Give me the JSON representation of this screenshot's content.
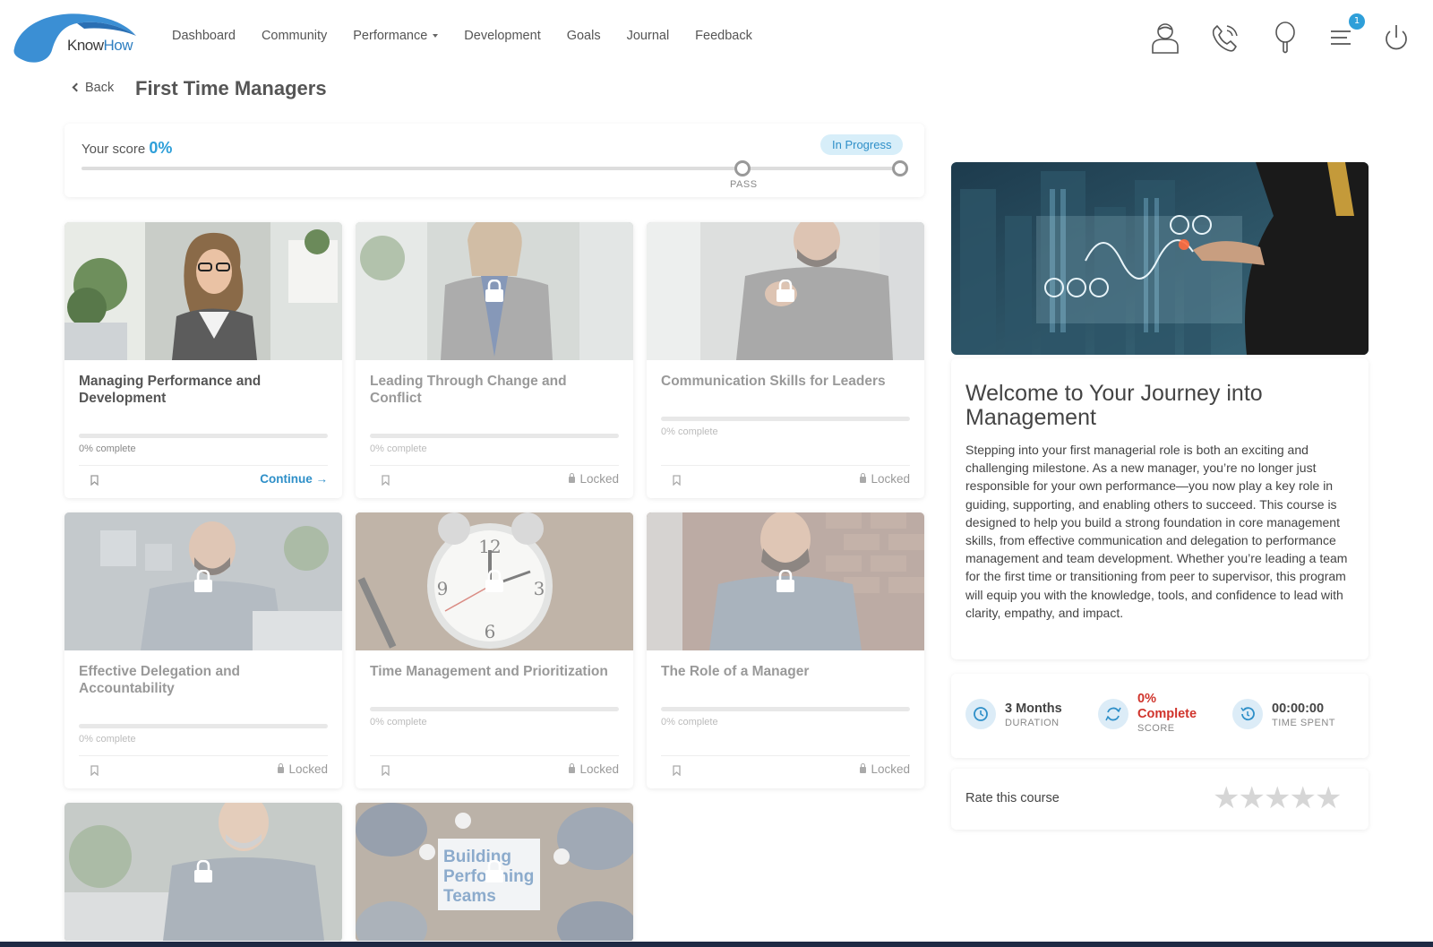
{
  "app": {
    "logo_text_1": "Know",
    "logo_text_2": "How",
    "notification_count": "1"
  },
  "nav": [
    {
      "label": "Dashboard"
    },
    {
      "label": "Community"
    },
    {
      "label": "Performance"
    },
    {
      "label": "Development"
    },
    {
      "label": "Goals"
    },
    {
      "label": "Journal"
    },
    {
      "label": "Feedback"
    }
  ],
  "header_icons": [
    "profile-icon",
    "phone-icon",
    "search-icon",
    "menu-icon",
    "power-icon"
  ],
  "page": {
    "back_label": "Back",
    "title": "First Time Managers"
  },
  "score": {
    "label": "Your score",
    "value": "0%",
    "status": "In Progress",
    "pass_label": "PASS",
    "progress_fraction": 0.0,
    "pass_fraction": 0.807
  },
  "courses": [
    {
      "title": "Managing Performance and Development",
      "complete": "0% complete",
      "progress": 0,
      "action": "Continue",
      "locked": false,
      "image": "woman-in-blazer"
    },
    {
      "title": "Leading Through Change and Conflict",
      "complete": "0% complete",
      "progress": 0,
      "action": "Locked",
      "locked": true,
      "image": "woman-at-window"
    },
    {
      "title": "Communication Skills for Leaders",
      "complete": "0% complete",
      "progress": 0,
      "action": "Locked",
      "locked": true,
      "image": "man-clasping-hands"
    },
    {
      "title": "Effective Delegation and Accountability",
      "complete": "0% complete",
      "progress": 0,
      "action": "Locked",
      "locked": true,
      "image": "man-thinking"
    },
    {
      "title": "Time Management and Prioritization",
      "complete": "0% complete",
      "progress": 0,
      "action": "Locked",
      "locked": true,
      "image": "alarm-clock"
    },
    {
      "title": "The Role of a Manager",
      "complete": "0% complete",
      "progress": 0,
      "action": "Locked",
      "locked": true,
      "image": "smiling-man-brick"
    },
    {
      "title": "",
      "complete": "",
      "progress": 0,
      "action": "Locked",
      "locked": true,
      "image": "man-with-laptop"
    },
    {
      "title": "",
      "complete": "",
      "progress": 0,
      "action": "Locked",
      "locked": true,
      "image": "building-performing-teams",
      "image_text": [
        "Building",
        "Performing",
        "Teams"
      ]
    }
  ],
  "welcome": {
    "title": "Welcome to Your Journey into Management",
    "body": "Stepping into your first managerial role is both an exciting and challenging milestone. As a new manager, you’re no longer just responsible for your own performance—you now play a key role in guiding, supporting, and enabling others to succeed. This course is designed to help you build a strong foundation in core management skills, from effective communication and delegation to performance management and team development. Whether you’re leading a team for the first time or transitioning from peer to supervisor, this program will equip you with the knowledge, tools, and confidence to lead with clarity, empathy, and impact."
  },
  "stats": [
    {
      "main": "3 Months",
      "sub": "DURATION",
      "icon": "clock-icon",
      "color": "#444444"
    },
    {
      "main": "0% Complete",
      "main_line1": "0%",
      "main_line2": "Complete",
      "sub": "SCORE",
      "icon": "refresh-icon",
      "color": "#d0342c"
    },
    {
      "main": "00:00:00",
      "sub": "TIME SPENT",
      "icon": "history-icon",
      "color": "#444444"
    }
  ],
  "rating": {
    "label": "Rate this course",
    "stars": 5,
    "value": 0
  },
  "colors": {
    "accent": "#2e9fd9",
    "status_pill_bg": "#d7eef9",
    "score_red": "#d0342c"
  }
}
